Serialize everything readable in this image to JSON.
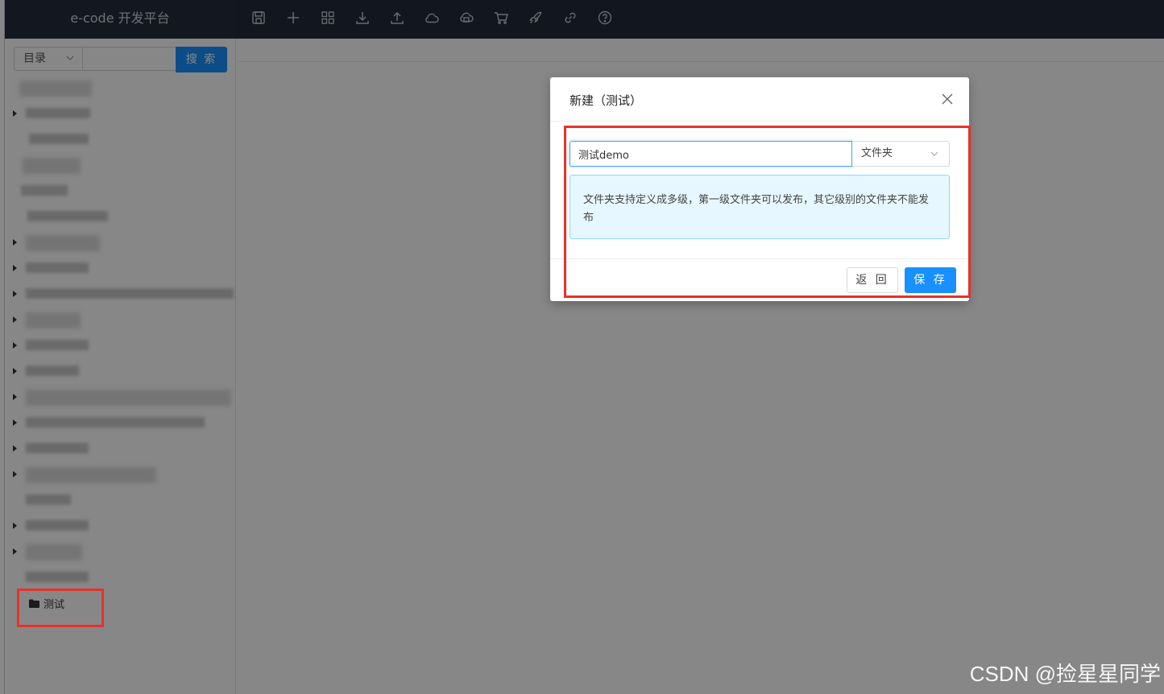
{
  "app": {
    "title": "e-code 开发平台"
  },
  "toolbar": {
    "icons": [
      "save-icon",
      "plus-icon",
      "grid-icon",
      "download-icon",
      "upload-icon",
      "cloud-icon",
      "cloud-upload-icon",
      "cart-icon",
      "rocket-icon",
      "link-icon",
      "help-icon"
    ]
  },
  "sidebar": {
    "category_select": "目录",
    "search_button": "搜 索",
    "tree_selected_label": "测试"
  },
  "modal": {
    "title": "新建（测试）",
    "name_value": "测试demo",
    "type_select": "文件夹",
    "info_text": "文件夹支持定义成多级，第一级文件夹可以发布，其它级别的文件夹不能发布",
    "back_button": "返 回",
    "save_button": "保 存"
  },
  "watermark": "CSDN @捡星星同学",
  "colors": {
    "accent": "#1890ff",
    "highlight": "#e8312a",
    "topbar": "#232a39"
  }
}
